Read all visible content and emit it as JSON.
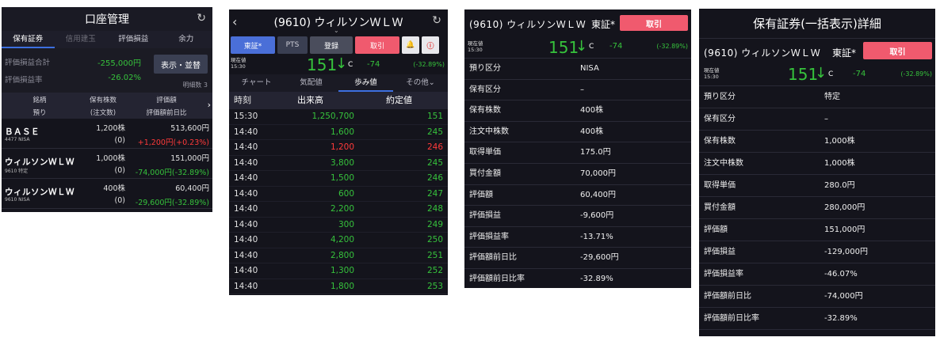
{
  "colors": {
    "gain": "#36c23c",
    "loss": "#ff3a3a",
    "accent": "#3d6fe0",
    "trade": "#f05a6e"
  },
  "account": {
    "title": "口座管理",
    "tabs": [
      "保有証券",
      "信用建玉",
      "評価損益",
      "余力"
    ],
    "total_label": "評価損益合計",
    "total_value": "-255,000円",
    "rate_label": "評価損益率",
    "rate_value": "-26.02%",
    "sort_button": "表示・並替",
    "detail_count": "明細数 3",
    "columns": {
      "c1a": "銘柄",
      "c1b": "預り",
      "c2a": "保有株数",
      "c2b": "(注文数)",
      "c3a": "評価額",
      "c3b": "評価額前日比"
    },
    "holdings": [
      {
        "name": "ＢＡＳＥ",
        "code": "4477 NISA",
        "qty": "1,200株",
        "order": "(0)",
        "value": "513,600円",
        "change": "+1,200円(+0.23%)"
      },
      {
        "name": "ウィルソンＷＬＷ",
        "code": "9610 特定",
        "qty": "1,000株",
        "order": "(0)",
        "value": "151,000円",
        "change": "-74,000円(-32.89%)"
      },
      {
        "name": "ウィルソンＷＬＷ",
        "code": "9610 NISA",
        "qty": "400株",
        "order": "(0)",
        "value": "60,400円",
        "change": "-29,600円(-32.89%)"
      }
    ]
  },
  "quote": {
    "title": "(9610) ウィルソンＷＬＷ",
    "buttons": {
      "tse": "東証*",
      "pts": "PTS",
      "register": "登録",
      "trade": "取引"
    },
    "price_label_1": "現在値",
    "price_label_2": "15:30",
    "price": "151",
    "price_flag": "C",
    "change": "-74",
    "change_pct": "(-32.89%)",
    "tabs": [
      "チャート",
      "気配値",
      "歩み値",
      "その他"
    ],
    "headers": {
      "time": "時刻",
      "volume": "出来高",
      "price": "約定値"
    },
    "ticks": [
      {
        "time": "15:30",
        "volume": "1,250,700",
        "price": "151",
        "dir": "down"
      },
      {
        "time": "14:40",
        "volume": "1,600",
        "price": "245",
        "dir": "down"
      },
      {
        "time": "14:40",
        "volume": "1,200",
        "price": "246",
        "dir": "up"
      },
      {
        "time": "14:40",
        "volume": "3,800",
        "price": "245",
        "dir": "down"
      },
      {
        "time": "14:40",
        "volume": "1,500",
        "price": "246",
        "dir": "down"
      },
      {
        "time": "14:40",
        "volume": "600",
        "price": "247",
        "dir": "down"
      },
      {
        "time": "14:40",
        "volume": "2,200",
        "price": "248",
        "dir": "down"
      },
      {
        "time": "14:40",
        "volume": "300",
        "price": "249",
        "dir": "down"
      },
      {
        "time": "14:40",
        "volume": "4,200",
        "price": "250",
        "dir": "down"
      },
      {
        "time": "14:40",
        "volume": "2,800",
        "price": "251",
        "dir": "down"
      },
      {
        "time": "14:40",
        "volume": "1,300",
        "price": "252",
        "dir": "down"
      },
      {
        "time": "14:40",
        "volume": "1,800",
        "price": "253",
        "dir": "down"
      }
    ]
  },
  "detail_nisa": {
    "stock": "(9610) ウィルソンＷＬＷ",
    "market": "東証*",
    "trade": "取引",
    "price_label_1": "現在値",
    "price_label_2": "15:30",
    "price": "151",
    "price_flag": "C",
    "change": "-74",
    "change_pct": "(-32.89%)",
    "rows": [
      {
        "k": "預り区分",
        "v": "NISA",
        "tone": ""
      },
      {
        "k": "保有区分",
        "v": "–",
        "tone": ""
      },
      {
        "k": "保有株数",
        "v": "400株",
        "tone": ""
      },
      {
        "k": "注文中株数",
        "v": "400株",
        "tone": ""
      },
      {
        "k": "取得単価",
        "v": "175.0円",
        "tone": ""
      },
      {
        "k": "買付金額",
        "v": "70,000円",
        "tone": ""
      },
      {
        "k": "評価額",
        "v": "60,400円",
        "tone": ""
      },
      {
        "k": "評価損益",
        "v": "-9,600円",
        "tone": "green"
      },
      {
        "k": "評価損益率",
        "v": "-13.71%",
        "tone": "green"
      },
      {
        "k": "評価額前日比",
        "v": "-29,600円",
        "tone": "green"
      },
      {
        "k": "評価額前日比率",
        "v": "-32.89%",
        "tone": "green"
      }
    ]
  },
  "detail_tokutei": {
    "title": "保有証券(一括表示)詳細",
    "stock": "(9610) ウィルソンＷＬＷ",
    "market": "東証*",
    "trade": "取引",
    "price_label_1": "現在値",
    "price_label_2": "15:30",
    "price": "151",
    "price_flag": "C",
    "change": "-74",
    "change_pct": "(-32.89%)",
    "rows": [
      {
        "k": "預り区分",
        "v": "特定",
        "tone": ""
      },
      {
        "k": "保有区分",
        "v": "–",
        "tone": ""
      },
      {
        "k": "保有株数",
        "v": "1,000株",
        "tone": ""
      },
      {
        "k": "注文中株数",
        "v": "1,000株",
        "tone": ""
      },
      {
        "k": "取得単価",
        "v": "280.0円",
        "tone": ""
      },
      {
        "k": "買付金額",
        "v": "280,000円",
        "tone": ""
      },
      {
        "k": "評価額",
        "v": "151,000円",
        "tone": ""
      },
      {
        "k": "評価損益",
        "v": "-129,000円",
        "tone": "green"
      },
      {
        "k": "評価損益率",
        "v": "-46.07%",
        "tone": "green"
      },
      {
        "k": "評価額前日比",
        "v": "-74,000円",
        "tone": "green"
      },
      {
        "k": "評価額前日比率",
        "v": "-32.89%",
        "tone": "green"
      }
    ]
  }
}
